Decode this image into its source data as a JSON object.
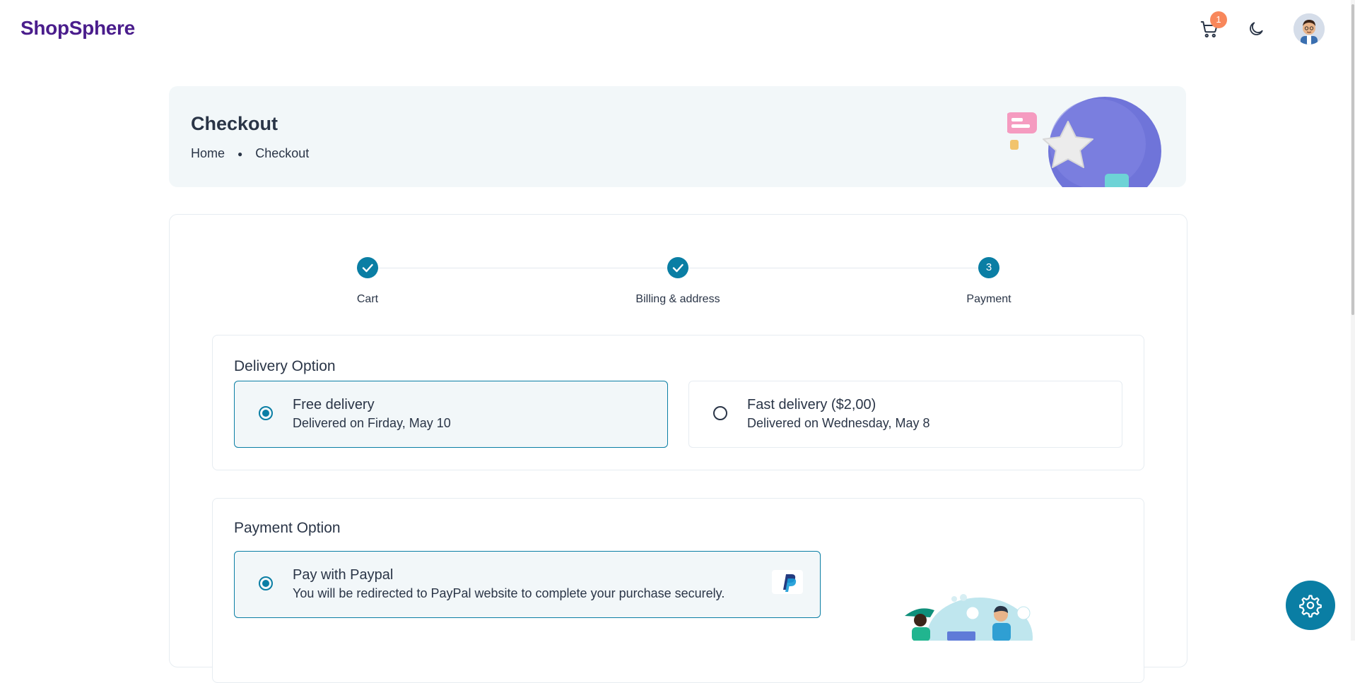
{
  "header": {
    "brand": "ShopSphere",
    "cart_count": "1"
  },
  "hero": {
    "title": "Checkout",
    "breadcrumb": [
      "Home",
      "Checkout"
    ]
  },
  "stepper": {
    "steps": [
      {
        "label": "Cart",
        "state": "done"
      },
      {
        "label": "Billing & address",
        "state": "done"
      },
      {
        "label": "Payment",
        "state": "current",
        "number": "3"
      }
    ]
  },
  "delivery": {
    "title": "Delivery Option",
    "options": [
      {
        "title": "Free delivery",
        "subtitle": "Delivered on Firday, May 10",
        "selected": true
      },
      {
        "title": "Fast delivery ($2,00)",
        "subtitle": "Delivered on Wednesday, May 8",
        "selected": false
      }
    ]
  },
  "payment": {
    "title": "Payment Option",
    "options": [
      {
        "title": "Pay with Paypal",
        "subtitle": "You will be redirected to PayPal website to complete your purchase securely.",
        "selected": true
      }
    ]
  },
  "colors": {
    "brand": "#4a1d8c",
    "accent": "#0a7ea4",
    "badge": "#f8875b"
  }
}
